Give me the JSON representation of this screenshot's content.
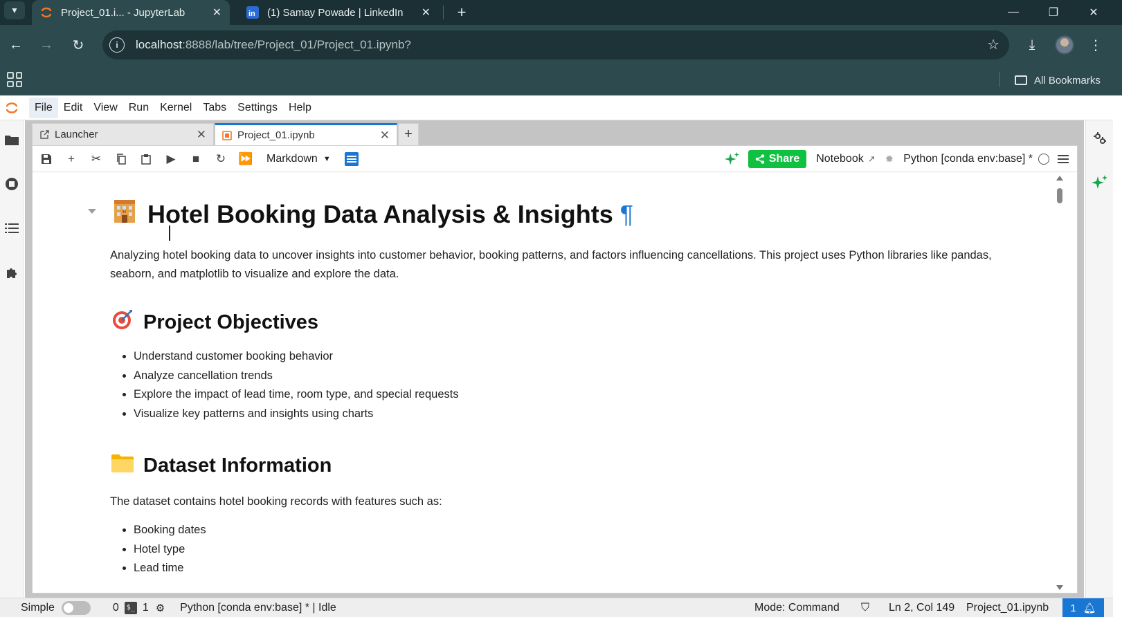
{
  "browser": {
    "tabs": [
      {
        "title": "Project_01.i... - JupyterLab",
        "active": true
      },
      {
        "title": "(1) Samay Powade | LinkedIn",
        "active": false
      }
    ],
    "url_host": "localhost",
    "url_rest": ":8888/lab/tree/Project_01/Project_01.ipynb?",
    "bookmarks_label": "All Bookmarks"
  },
  "menubar": {
    "items": [
      "File",
      "Edit",
      "View",
      "Run",
      "Kernel",
      "Tabs",
      "Settings",
      "Help"
    ]
  },
  "dock": {
    "tabs": [
      {
        "label": "Launcher"
      },
      {
        "label": "Project_01.ipynb"
      }
    ]
  },
  "toolbar": {
    "cell_type": "Markdown",
    "share_label": "Share",
    "notebook_label": "Notebook",
    "kernel": "Python [conda env:base] *"
  },
  "notebook": {
    "title": "Hotel Booking Data Analysis & Insights",
    "title_anchor": "¶",
    "intro": "Analyzing hotel booking data to uncover insights into customer behavior, booking patterns, and factors influencing cancellations. This project uses Python libraries like pandas, seaborn, and matplotlib to visualize and explore the data.",
    "objectives_heading": "Project Objectives",
    "objectives": [
      "Understand customer booking behavior",
      "Analyze cancellation trends",
      "Explore the impact of lead time, room type, and special requests",
      "Visualize key patterns and insights using charts"
    ],
    "dataset_heading": "Dataset Information",
    "dataset_intro": "The dataset contains hotel booking records with features such as:",
    "dataset_features": [
      "Booking dates",
      "Hotel type",
      "Lead time"
    ]
  },
  "statusbar": {
    "mode_label": "Simple",
    "terminals_count": "0",
    "kernels_count": "1",
    "kernel_status": "Python [conda env:base] * | Idle",
    "command_mode": "Mode: Command",
    "cursor_pos": "Ln 2, Col 149",
    "file_name": "Project_01.ipynb",
    "notifications": "1"
  },
  "colors": {
    "accent": "#1976d2",
    "share": "#10c040",
    "chrome": "#2d4a4e"
  }
}
